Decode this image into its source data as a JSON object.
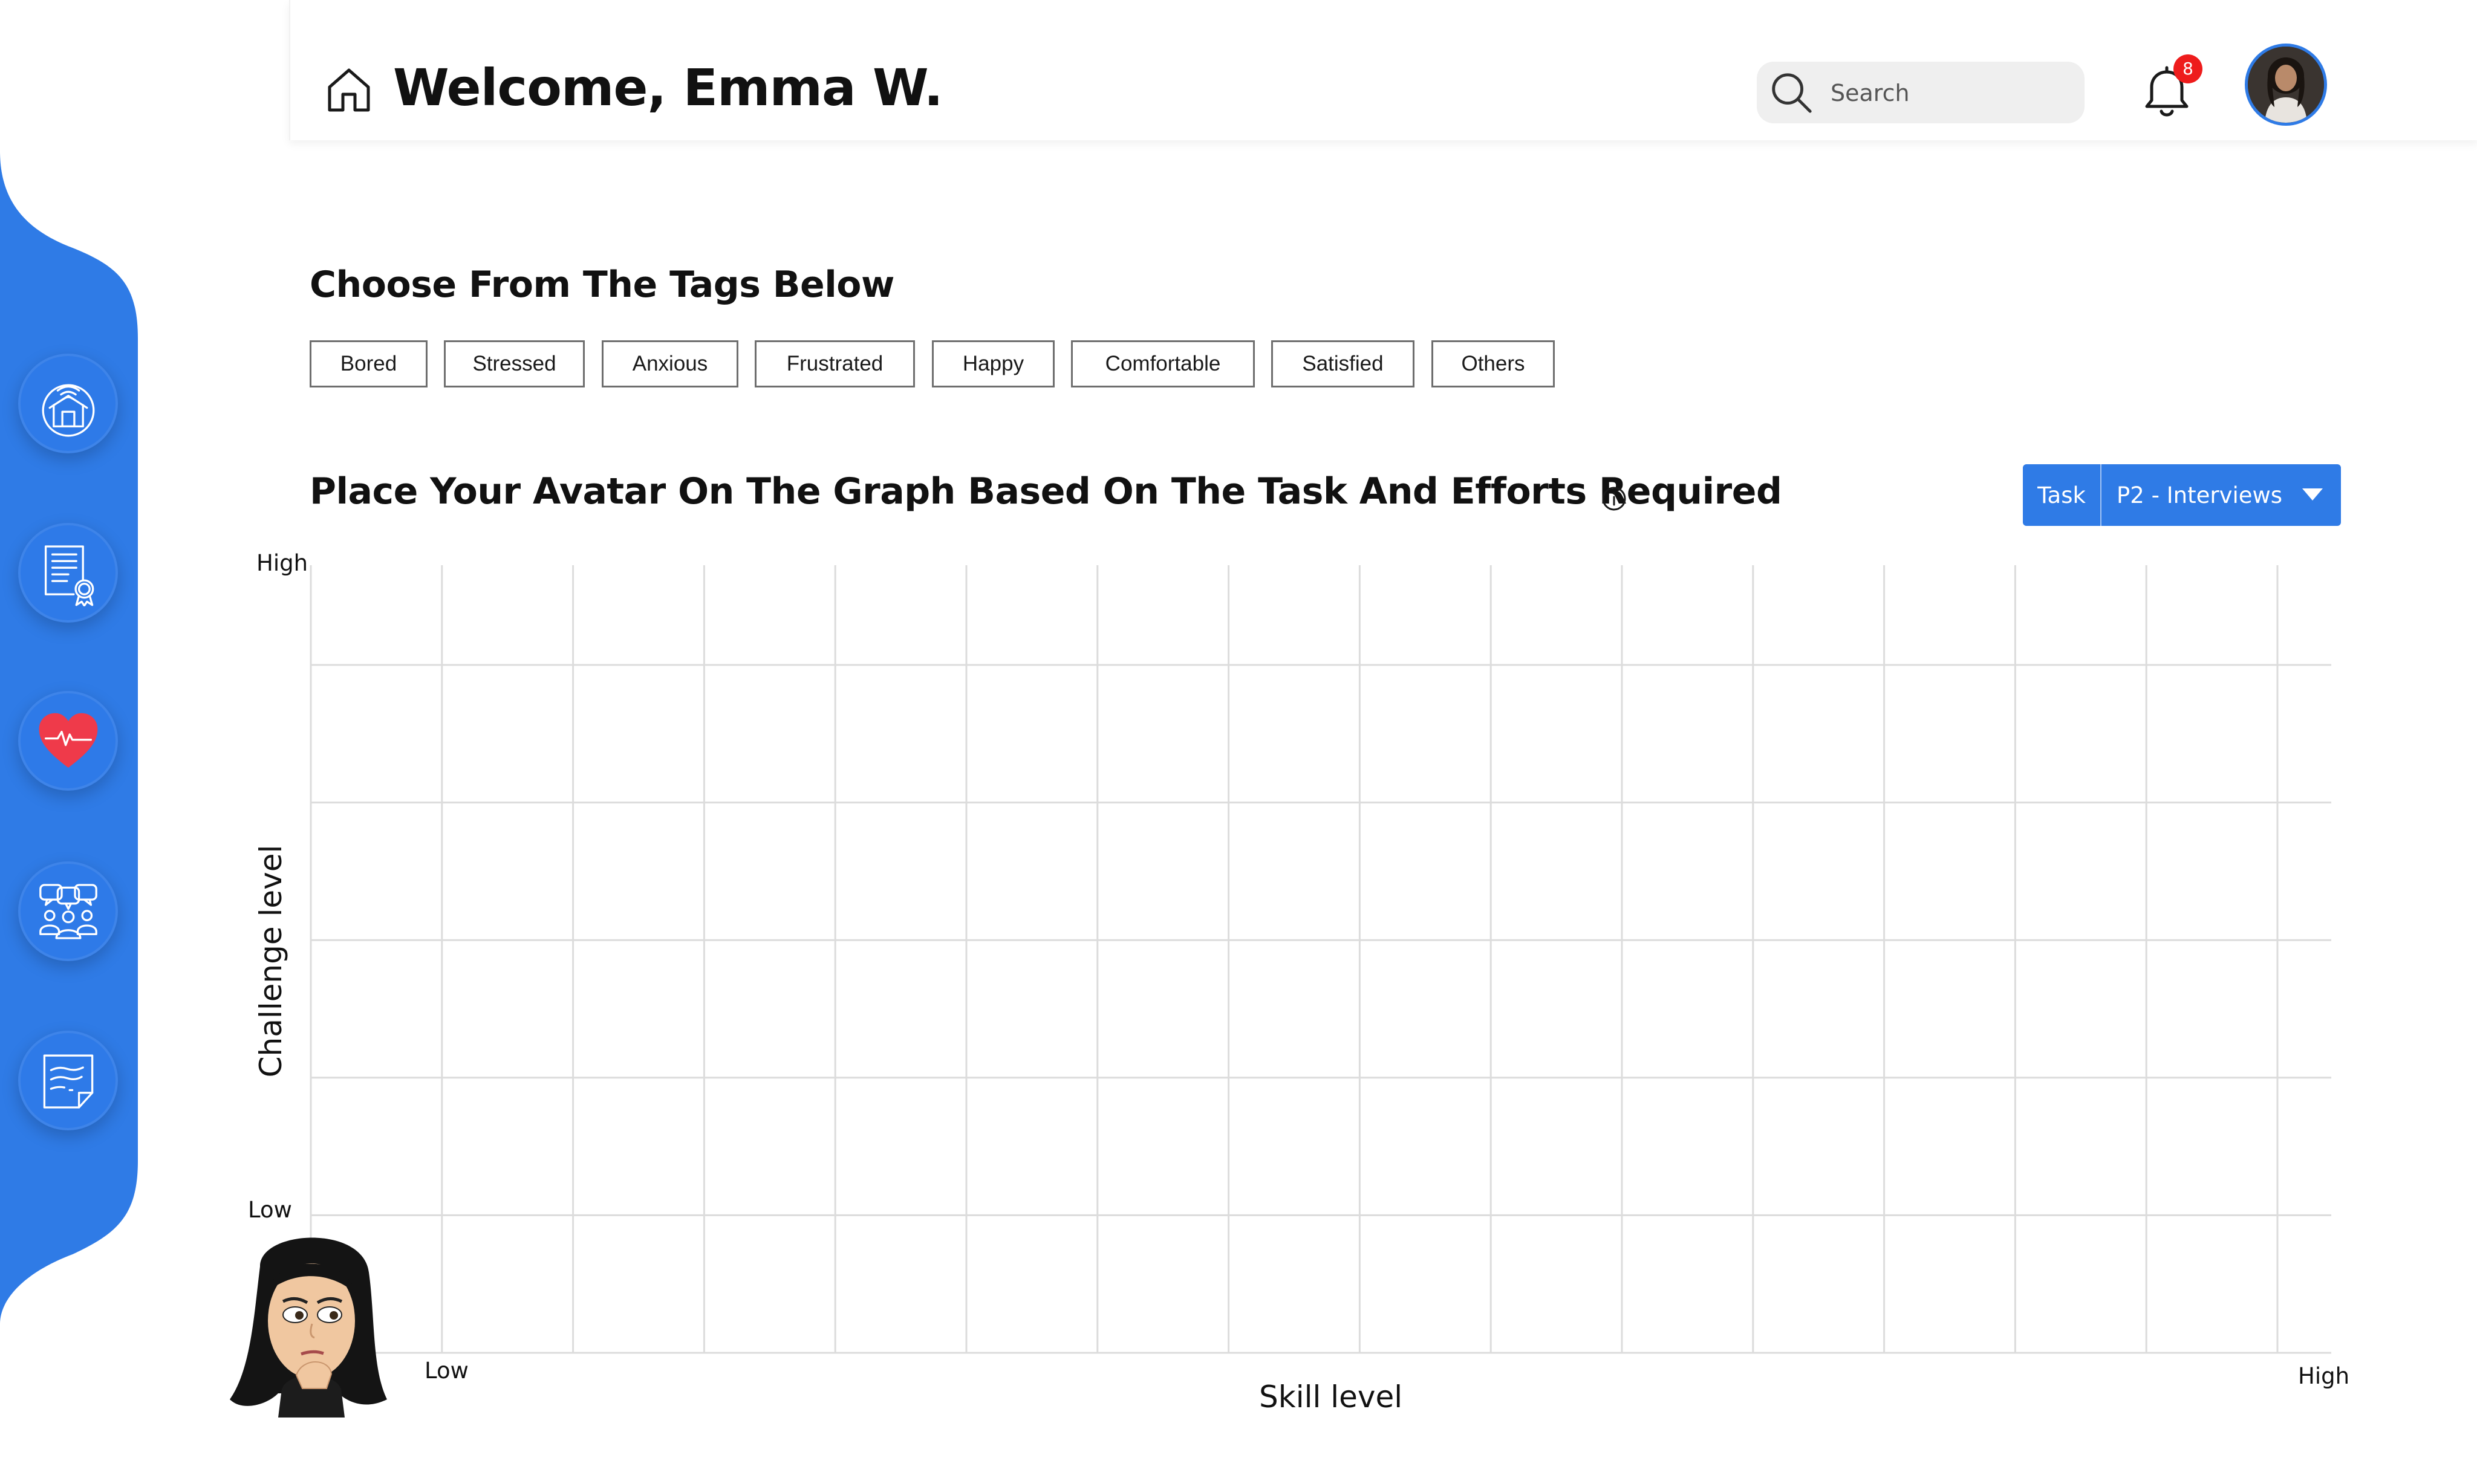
{
  "header": {
    "welcome_text": "Welcome, Emma W.",
    "search_placeholder": "Search",
    "notification_count": "8"
  },
  "tags_section": {
    "title": "Choose From The Tags Below",
    "tags": [
      "Bored",
      "Stressed",
      "Anxious",
      "Frustrated",
      "Happy",
      "Comfortable",
      "Satisfied",
      "Others"
    ]
  },
  "graph_section": {
    "title": "Place Your Avatar On The Graph Based On The Task And Efforts Required",
    "task_dropdown": {
      "label": "Task",
      "selected": "P2 - Interviews"
    },
    "y_axis": {
      "title": "Challenge level",
      "high": "High",
      "low": "Low"
    },
    "x_axis": {
      "title": "Skill level",
      "low": "Low",
      "high": "High"
    },
    "grid": {
      "columns": 15,
      "rows": 6
    }
  },
  "sidebar": {
    "items": [
      {
        "icon": "smart-home-icon"
      },
      {
        "icon": "certificate-icon"
      },
      {
        "icon": "heart-rate-icon"
      },
      {
        "icon": "team-chat-icon"
      },
      {
        "icon": "notes-icon"
      }
    ]
  },
  "colors": {
    "primary": "#2f7be6",
    "sidebar": "#2f7be6",
    "badge": "#ee1c1c",
    "heart": "#ef3a4a",
    "grid_line": "#dcdcdc"
  }
}
